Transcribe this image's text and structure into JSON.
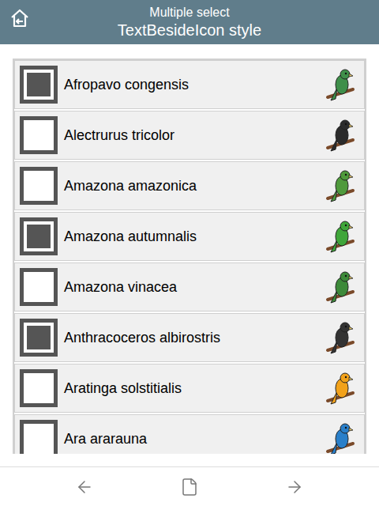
{
  "header": {
    "title": "Multiple select",
    "subtitle": "TextBesideIcon style"
  },
  "items": [
    {
      "label": "Afropavo congensis",
      "checked": true,
      "color": "#3f8f4a"
    },
    {
      "label": "Alectrurus tricolor",
      "checked": false,
      "color": "#2b2b2b"
    },
    {
      "label": "Amazona amazonica",
      "checked": false,
      "color": "#4f9a3c"
    },
    {
      "label": "Amazona autumnalis",
      "checked": true,
      "color": "#3fa63a"
    },
    {
      "label": "Amazona vinacea",
      "checked": false,
      "color": "#3d8a3a"
    },
    {
      "label": "Anthracoceros albirostris",
      "checked": true,
      "color": "#333333"
    },
    {
      "label": "Aratinga solstitialis",
      "checked": false,
      "color": "#f2a21b"
    },
    {
      "label": "Ara ararauna",
      "checked": false,
      "color": "#2a7fc9"
    }
  ]
}
